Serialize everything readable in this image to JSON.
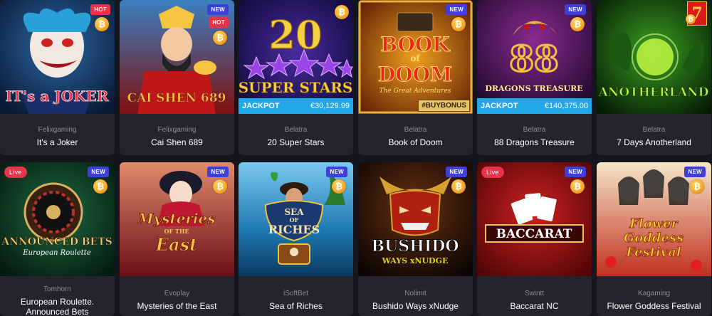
{
  "games": [
    {
      "provider": "Felixgaming",
      "title": "It's a Joker",
      "badges": [
        "HOT"
      ],
      "art_text": "IT's a JOKER",
      "colors": {
        "bg": "#12345a",
        "accent": "#e8334a"
      }
    },
    {
      "provider": "Felixgaming",
      "title": "Cai Shen 689",
      "badges": [
        "NEW",
        "HOT"
      ],
      "art_text": "CAI SHEN 689",
      "colors": {
        "bg": "#7a1010",
        "accent": "#f5c542"
      }
    },
    {
      "provider": "Belatra",
      "title": "20 Super Stars",
      "badges": [],
      "art_text_top": "20",
      "art_text": "SUPER STARS",
      "jackpot": {
        "label": "JACKPOT",
        "amount": "€30,129.99"
      },
      "colors": {
        "bg": "#1c1760",
        "accent": "#8a3de0"
      }
    },
    {
      "provider": "Belatra",
      "title": "Book of Doom",
      "badges": [
        "NEW"
      ],
      "art_text_top": "BOOK",
      "art_text_mid": "of",
      "art_text": "DOOM",
      "art_subtitle": "The Great Adventures",
      "buybonus": "#BUYBONUS",
      "colors": {
        "bg": "#7a2a06",
        "accent": "#f0a020"
      }
    },
    {
      "provider": "Belatra",
      "title": "88 Dragons Treasure",
      "badges": [
        "NEW"
      ],
      "art_text_top": "88",
      "art_text": "DRAGONS TREASURE",
      "jackpot": {
        "label": "JACKPOT",
        "amount": "€140,375.00"
      },
      "colors": {
        "bg": "#3a0f52",
        "accent": "#f0b030"
      }
    },
    {
      "provider": "Belatra",
      "title": "7 Days Anotherland",
      "badges": [],
      "art_text": "ANOTHERLAND",
      "art_digit": "7",
      "colors": {
        "bg": "#0c3010",
        "accent": "#7fe03a"
      }
    },
    {
      "provider": "Tomhorn",
      "title": "European Roulette. Announced Bets",
      "badges": [
        "Live",
        "NEW"
      ],
      "art_text": "ANNOUNCED BETS",
      "art_subtitle": "European Roulette",
      "colors": {
        "bg": "#0e3a26",
        "accent": "#e8c15a"
      }
    },
    {
      "provider": "Evoplay",
      "title": "Mysteries of the East",
      "badges": [
        "NEW"
      ],
      "art_text_top": "Mysteries",
      "art_text_mid": "OF THE",
      "art_text": "East",
      "colors": {
        "bg": "#7a1a20",
        "accent": "#f5c542"
      }
    },
    {
      "provider": "iSoftBet",
      "title": "Sea of Riches",
      "badges": [
        "NEW"
      ],
      "art_text_top": "SEA",
      "art_text_mid": "OF",
      "art_text": "RICHES",
      "colors": {
        "bg": "#1e78b0",
        "accent": "#f0c040"
      }
    },
    {
      "provider": "Nolimit",
      "title": "Bushido Ways xNudge",
      "badges": [
        "NEW"
      ],
      "art_text": "BUSHIDO",
      "art_subtitle": "WAYS xNUDGE",
      "colors": {
        "bg": "#1a0d08",
        "accent": "#d8a030"
      }
    },
    {
      "provider": "Swintt",
      "title": "Baccarat NC",
      "badges": [
        "Live",
        "NEW"
      ],
      "art_text": "BACCARAT",
      "colors": {
        "bg": "#a01414",
        "accent": "#e8c15a"
      }
    },
    {
      "provider": "Kagaming",
      "title": "Flower Goddess Festival",
      "badges": [
        "NEW"
      ],
      "art_text_top": "Flower",
      "art_text_mid": "Goddess",
      "art_text": "Festival",
      "colors": {
        "bg": "#e8d0a0",
        "accent": "#f0c020"
      }
    }
  ],
  "coin_symbol": "₿",
  "icons": {
    "coin": "bitcoin-coin-icon"
  }
}
